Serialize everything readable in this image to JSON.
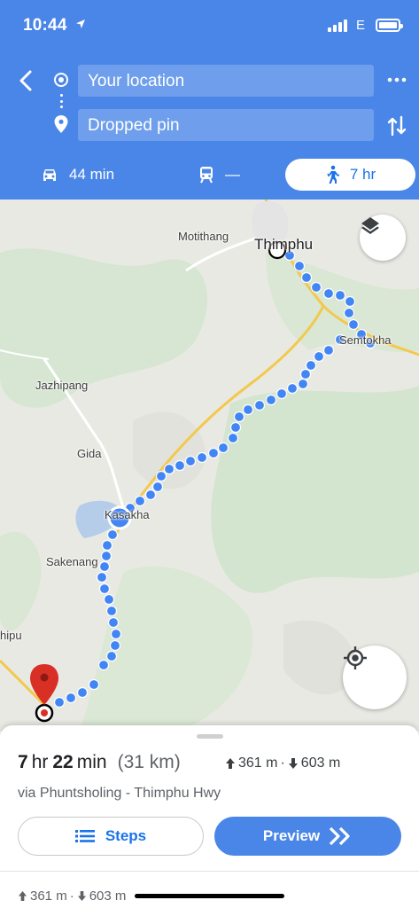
{
  "status_bar": {
    "time": "10:44",
    "network": "E"
  },
  "directions": {
    "from_value": "Your location",
    "to_value": "Dropped pin"
  },
  "modes": [
    {
      "icon": "car-icon",
      "label": "44 min"
    },
    {
      "icon": "train-icon",
      "label": "—"
    },
    {
      "icon": "walking-icon",
      "label": "7 hr",
      "selected": true
    }
  ],
  "map": {
    "labels": [
      "Motithang",
      "Thimphu",
      "Semtokha",
      "Jazhipang",
      "Gida",
      "Kasakha",
      "Sakenang",
      "hipu"
    ]
  },
  "route_summary": {
    "hours": "7",
    "hours_unit": "hr",
    "minutes": "22",
    "minutes_unit": "min",
    "distance": "(31 km)",
    "ascent": "361 m",
    "descent": "603 m",
    "separator": "·",
    "via": "via Phuntsholing - Thimphu Hwy",
    "steps_label": "Steps",
    "preview_label": "Preview"
  },
  "colors": {
    "accent": "#4a86e8",
    "route": "#4285f4",
    "link": "#1a73e8",
    "pin": "#d93025"
  }
}
